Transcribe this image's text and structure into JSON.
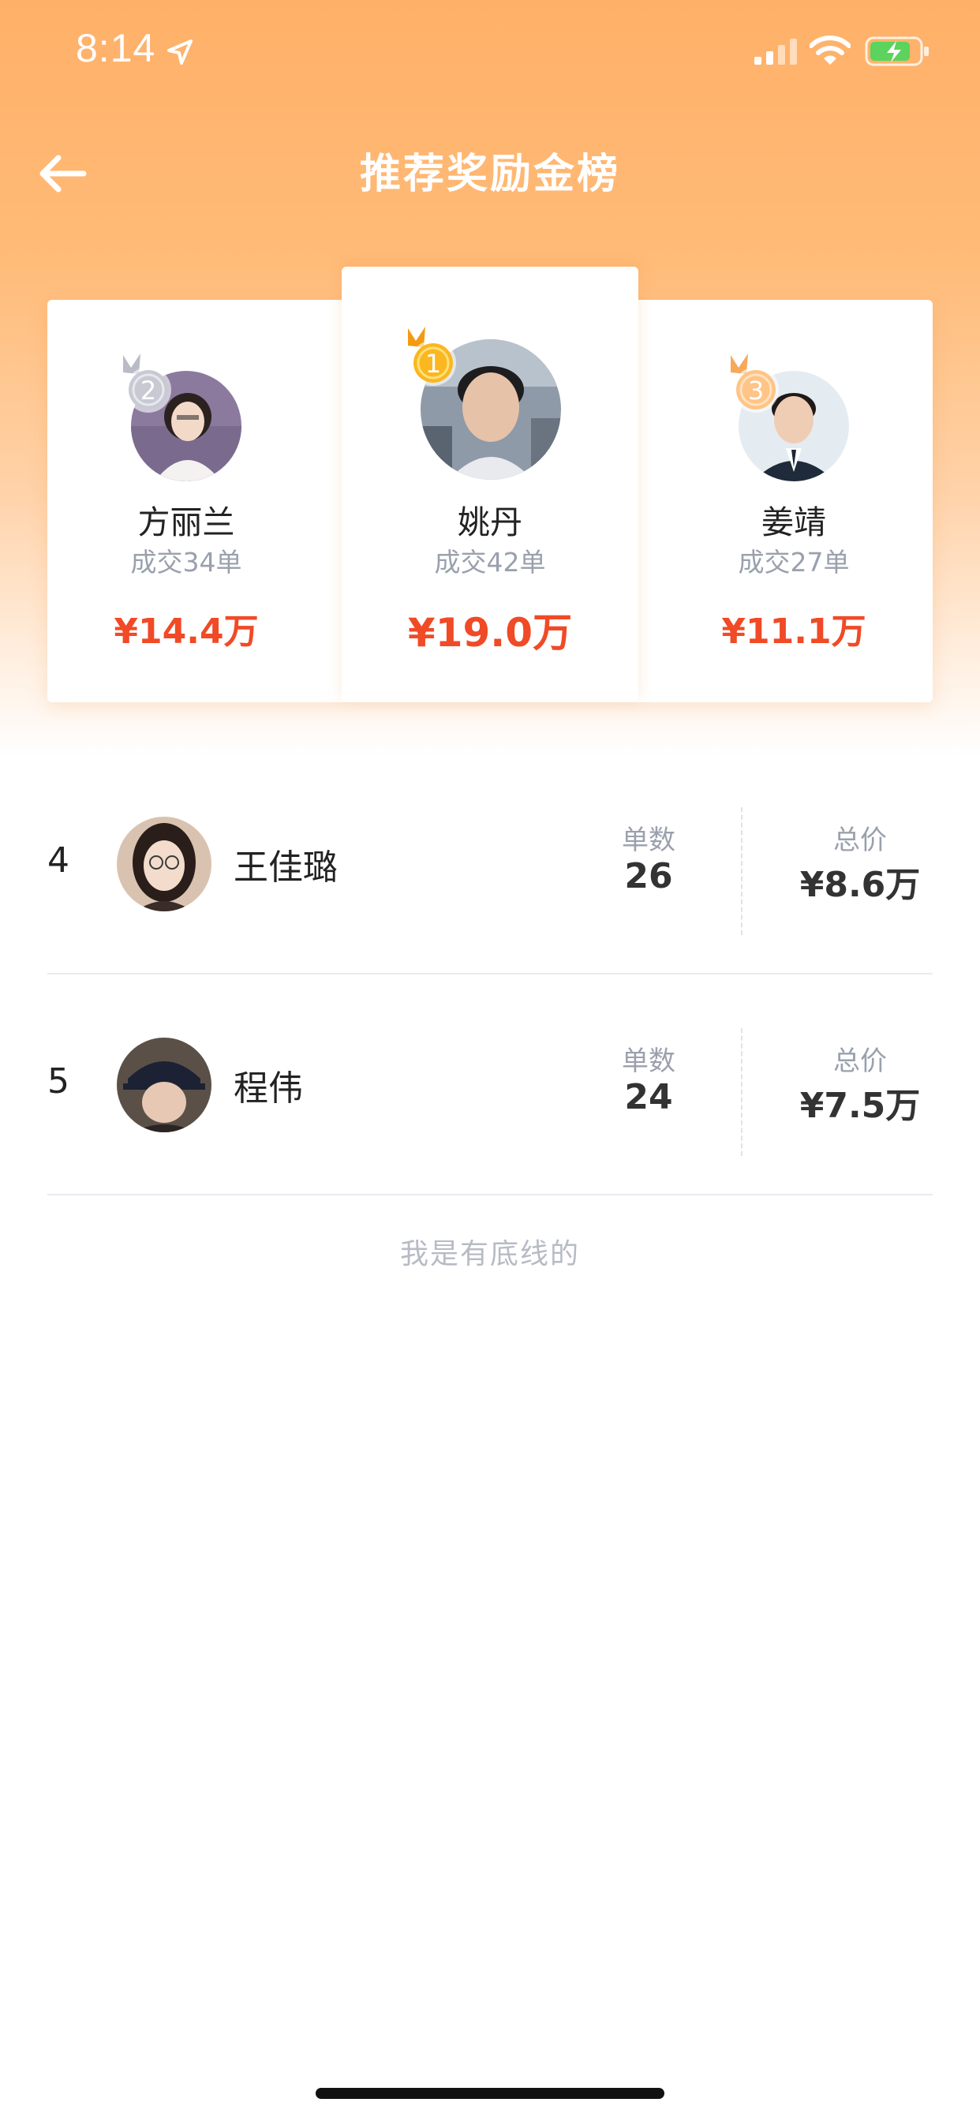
{
  "status_bar": {
    "time": "8:14"
  },
  "header": {
    "title": "推荐奖励金榜"
  },
  "podium": [
    {
      "rank": "2",
      "name": "方丽兰",
      "deals": "成交34单",
      "amount": "¥14.4万",
      "medal_color": "#b9bcc6"
    },
    {
      "rank": "1",
      "name": "姚丹",
      "deals": "成交42单",
      "amount": "¥19.0万",
      "medal_color": "#f8b51c"
    },
    {
      "rank": "3",
      "name": "姜靖",
      "deals": "成交27单",
      "amount": "¥11.1万",
      "medal_color": "#ffc486"
    }
  ],
  "list_labels": {
    "count": "单数",
    "total": "总价"
  },
  "list": [
    {
      "rank": "4",
      "name": "王佳璐",
      "count": "26",
      "total": "¥8.6万"
    },
    {
      "rank": "5",
      "name": "程伟",
      "count": "24",
      "total": "¥7.5万"
    }
  ],
  "footer": "我是有底线的",
  "colors": {
    "accent": "#ffb068",
    "amount": "#f04a26"
  }
}
